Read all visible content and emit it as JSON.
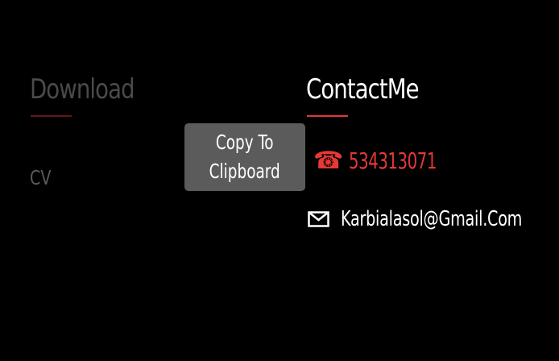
{
  "download": {
    "title": "Download",
    "cv_label": "CV"
  },
  "contact": {
    "title": "ContactMe",
    "phone": "534313071",
    "email": "Karbialasol@Gmail.Com",
    "phone_icon": "phone-icon",
    "email_icon": "mail-icon"
  },
  "tooltip": {
    "line1": "Copy To",
    "line2": "Clipboard"
  },
  "colors": {
    "background": "#000000",
    "accent": "#e53935",
    "muted_text": "#4a4a4a",
    "tooltip_bg": "#5b5b5b"
  }
}
